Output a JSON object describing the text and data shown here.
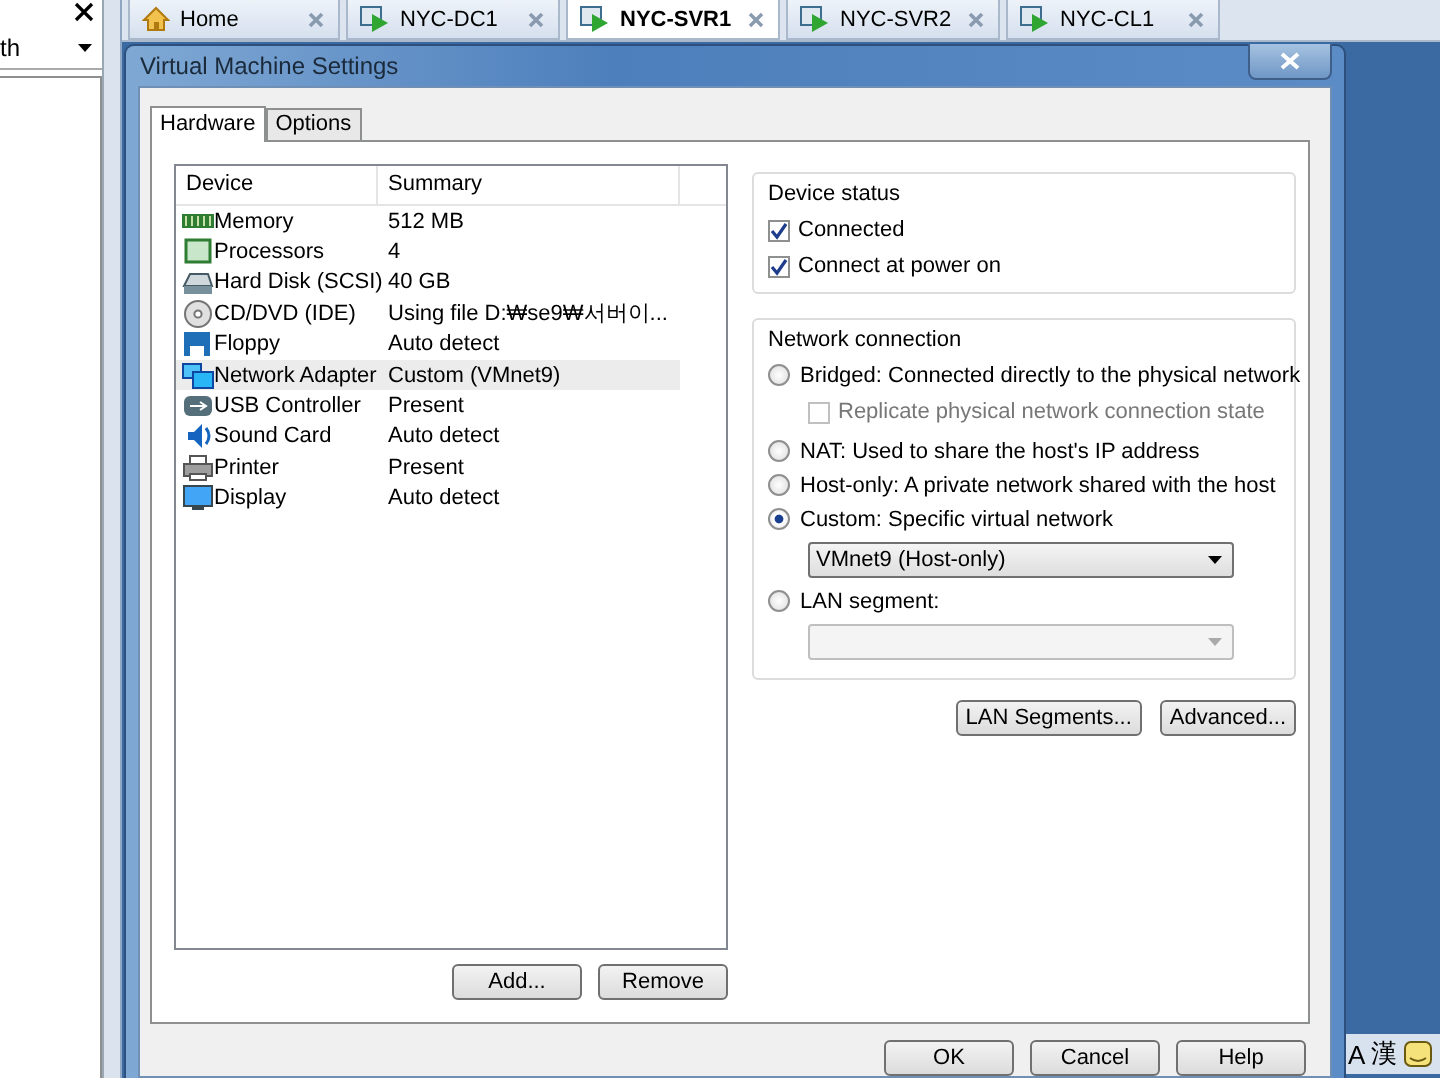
{
  "sidebar": {
    "search": {
      "value": "th"
    }
  },
  "vm_tabs": [
    {
      "label": "Home",
      "kind": "home",
      "selected": false
    },
    {
      "label": "NYC-DC1",
      "kind": "vm",
      "selected": false
    },
    {
      "label": "NYC-SVR1",
      "kind": "vm",
      "selected": true
    },
    {
      "label": "NYC-SVR2",
      "kind": "vm",
      "selected": false
    },
    {
      "label": "NYC-CL1",
      "kind": "vm",
      "selected": false
    }
  ],
  "dialog": {
    "title": "Virtual Machine Settings",
    "tabs": [
      {
        "label": "Hardware",
        "selected": true
      },
      {
        "label": "Options",
        "selected": false
      }
    ],
    "devices": {
      "columns": [
        "Device",
        "Summary"
      ],
      "rows": [
        {
          "device": "Memory",
          "summary": "512 MB",
          "kind": "memory",
          "selected": false
        },
        {
          "device": "Processors",
          "summary": "4",
          "kind": "cpu",
          "selected": false
        },
        {
          "device": "Hard Disk (SCSI)",
          "summary": "40 GB",
          "kind": "disk",
          "selected": false
        },
        {
          "device": "CD/DVD (IDE)",
          "summary": "Using file D:₩se9₩서버이...",
          "kind": "cd",
          "selected": false
        },
        {
          "device": "Floppy",
          "summary": "Auto detect",
          "kind": "floppy",
          "selected": false
        },
        {
          "device": "Network Adapter",
          "summary": "Custom (VMnet9)",
          "kind": "network",
          "selected": true
        },
        {
          "device": "USB Controller",
          "summary": "Present",
          "kind": "usb",
          "selected": false
        },
        {
          "device": "Sound Card",
          "summary": "Auto detect",
          "kind": "sound",
          "selected": false
        },
        {
          "device": "Printer",
          "summary": "Present",
          "kind": "printer",
          "selected": false
        },
        {
          "device": "Display",
          "summary": "Auto detect",
          "kind": "display",
          "selected": false
        }
      ]
    },
    "list_buttons": [
      "Add...",
      "Remove"
    ],
    "device_status": {
      "title": "Device status",
      "options": [
        {
          "label": "Connected",
          "checked": true
        },
        {
          "label": "Connect at power on",
          "checked": true
        }
      ]
    },
    "network_connection": {
      "title": "Network connection",
      "options": [
        {
          "kind": "radio",
          "label": "Bridged: Connected directly to the physical network",
          "selected": false
        },
        {
          "kind": "checkbox",
          "label": "Replicate physical network connection state",
          "checked": false,
          "disabled": true
        },
        {
          "kind": "radio",
          "label": "NAT: Used to share the host's IP address",
          "selected": false
        },
        {
          "kind": "radio",
          "label": "Host-only: A private network shared with the host",
          "selected": false
        },
        {
          "kind": "radio",
          "label": "Custom: Specific virtual network",
          "selected": true
        },
        {
          "kind": "dropdown",
          "value": "VMnet9 (Host-only)",
          "disabled": false
        },
        {
          "kind": "radio",
          "label": "LAN segment:",
          "selected": false
        },
        {
          "kind": "dropdown",
          "disabled": true
        }
      ]
    },
    "network_buttons": [
      "LAN Segments...",
      "Advanced..."
    ],
    "footer_buttons": [
      "OK",
      "Cancel",
      "Help"
    ]
  },
  "ime": [
    "A",
    "漢"
  ]
}
